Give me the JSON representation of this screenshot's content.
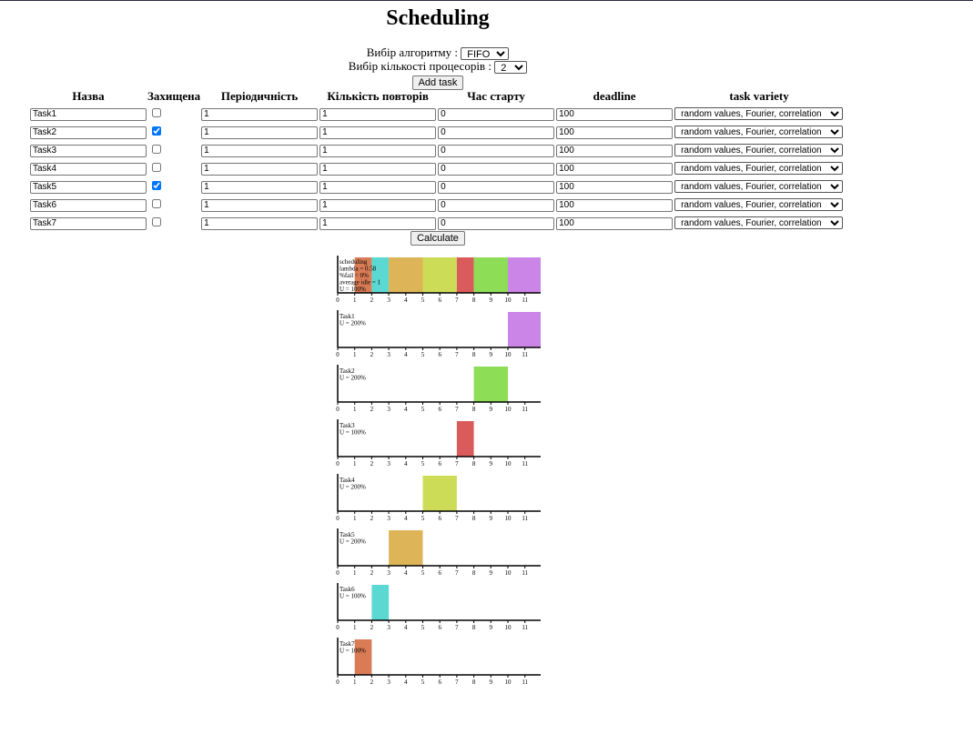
{
  "page": {
    "title": "Scheduling"
  },
  "controls": {
    "algorithm_label": "Вибір алгоритму :",
    "algorithm_value": "FIFO",
    "processors_label": "Вибір кількості процесорів :",
    "processors_value": "2",
    "add_task_label": "Add task",
    "calculate_label": "Calculate"
  },
  "table": {
    "headers": [
      "Назва",
      "Захищена",
      "Періодичність",
      "Кількість повторів",
      "Час старту",
      "deadline",
      "task variety"
    ],
    "rows": [
      {
        "name": "Task1",
        "protected": false,
        "period": "1",
        "repeats": "1",
        "start": "0",
        "deadline": "100",
        "variety": "random values, Fourier, correlation"
      },
      {
        "name": "Task2",
        "protected": true,
        "period": "1",
        "repeats": "1",
        "start": "0",
        "deadline": "100",
        "variety": "random values, Fourier, correlation"
      },
      {
        "name": "Task3",
        "protected": false,
        "period": "1",
        "repeats": "1",
        "start": "0",
        "deadline": "100",
        "variety": "random values, Fourier, correlation"
      },
      {
        "name": "Task4",
        "protected": false,
        "period": "1",
        "repeats": "1",
        "start": "0",
        "deadline": "100",
        "variety": "random values, Fourier, correlation"
      },
      {
        "name": "Task5",
        "protected": true,
        "period": "1",
        "repeats": "1",
        "start": "0",
        "deadline": "100",
        "variety": "random values, Fourier, correlation"
      },
      {
        "name": "Task6",
        "protected": false,
        "period": "1",
        "repeats": "1",
        "start": "0",
        "deadline": "100",
        "variety": "random values, Fourier, correlation"
      },
      {
        "name": "Task7",
        "protected": false,
        "period": "1",
        "repeats": "1",
        "start": "0",
        "deadline": "100",
        "variety": "random values, Fourier, correlation"
      }
    ]
  },
  "chart_data": [
    {
      "type": "bar",
      "name": "scheduling",
      "lines": [
        "scheduling",
        "lambda = 0.58",
        "%fail = 0%",
        "average idle = 1",
        "U = 100%"
      ],
      "xlim": [
        0,
        12
      ],
      "ticks": [
        0,
        1,
        2,
        3,
        4,
        5,
        6,
        7,
        8,
        9,
        10,
        11
      ],
      "bars": [
        {
          "task": "Task7",
          "start": 1,
          "end": 2,
          "color": "#d97b55"
        },
        {
          "task": "Task6",
          "start": 2,
          "end": 3,
          "color": "#5bd8d2"
        },
        {
          "task": "Task5",
          "start": 3,
          "end": 5,
          "color": "#ddb457"
        },
        {
          "task": "Task4",
          "start": 5,
          "end": 7,
          "color": "#cddc57"
        },
        {
          "task": "Task3",
          "start": 7,
          "end": 8,
          "color": "#d95b5b"
        },
        {
          "task": "Task2",
          "start": 8,
          "end": 10,
          "color": "#8ddd57"
        },
        {
          "task": "Task1",
          "start": 10,
          "end": 12,
          "color": "#cb85e6"
        }
      ]
    },
    {
      "type": "bar",
      "name": "Task1",
      "lines": [
        "Task1",
        "U = 200%"
      ],
      "xlim": [
        0,
        12
      ],
      "ticks": [
        0,
        1,
        2,
        3,
        4,
        5,
        6,
        7,
        8,
        9,
        10,
        11
      ],
      "bars": [
        {
          "task": "Task1",
          "start": 10,
          "end": 12,
          "color": "#cb85e6"
        }
      ]
    },
    {
      "type": "bar",
      "name": "Task2",
      "lines": [
        "Task2",
        "U = 200%"
      ],
      "xlim": [
        0,
        12
      ],
      "ticks": [
        0,
        1,
        2,
        3,
        4,
        5,
        6,
        7,
        8,
        9,
        10,
        11
      ],
      "bars": [
        {
          "task": "Task2",
          "start": 8,
          "end": 10,
          "color": "#8ddd57"
        }
      ]
    },
    {
      "type": "bar",
      "name": "Task3",
      "lines": [
        "Task3",
        "U = 100%"
      ],
      "xlim": [
        0,
        12
      ],
      "ticks": [
        0,
        1,
        2,
        3,
        4,
        5,
        6,
        7,
        8,
        9,
        10,
        11
      ],
      "bars": [
        {
          "task": "Task3",
          "start": 7,
          "end": 8,
          "color": "#d95b5b"
        }
      ]
    },
    {
      "type": "bar",
      "name": "Task4",
      "lines": [
        "Task4",
        "U = 200%"
      ],
      "xlim": [
        0,
        12
      ],
      "ticks": [
        0,
        1,
        2,
        3,
        4,
        5,
        6,
        7,
        8,
        9,
        10,
        11
      ],
      "bars": [
        {
          "task": "Task4",
          "start": 5,
          "end": 7,
          "color": "#cddc57"
        }
      ]
    },
    {
      "type": "bar",
      "name": "Task5",
      "lines": [
        "Task5",
        "U = 200%"
      ],
      "xlim": [
        0,
        12
      ],
      "ticks": [
        0,
        1,
        2,
        3,
        4,
        5,
        6,
        7,
        8,
        9,
        10,
        11
      ],
      "bars": [
        {
          "task": "Task5",
          "start": 3,
          "end": 5,
          "color": "#ddb457"
        }
      ]
    },
    {
      "type": "bar",
      "name": "Task6",
      "lines": [
        "Task6",
        "U = 100%"
      ],
      "xlim": [
        0,
        12
      ],
      "ticks": [
        0,
        1,
        2,
        3,
        4,
        5,
        6,
        7,
        8,
        9,
        10,
        11
      ],
      "bars": [
        {
          "task": "Task6",
          "start": 2,
          "end": 3,
          "color": "#5bd8d2"
        }
      ]
    },
    {
      "type": "bar",
      "name": "Task7",
      "lines": [
        "Task7",
        "U = 100%"
      ],
      "xlim": [
        0,
        12
      ],
      "ticks": [
        0,
        1,
        2,
        3,
        4,
        5,
        6,
        7,
        8,
        9,
        10,
        11
      ],
      "bars": [
        {
          "task": "Task7",
          "start": 1,
          "end": 2,
          "color": "#d97b55"
        }
      ]
    }
  ]
}
